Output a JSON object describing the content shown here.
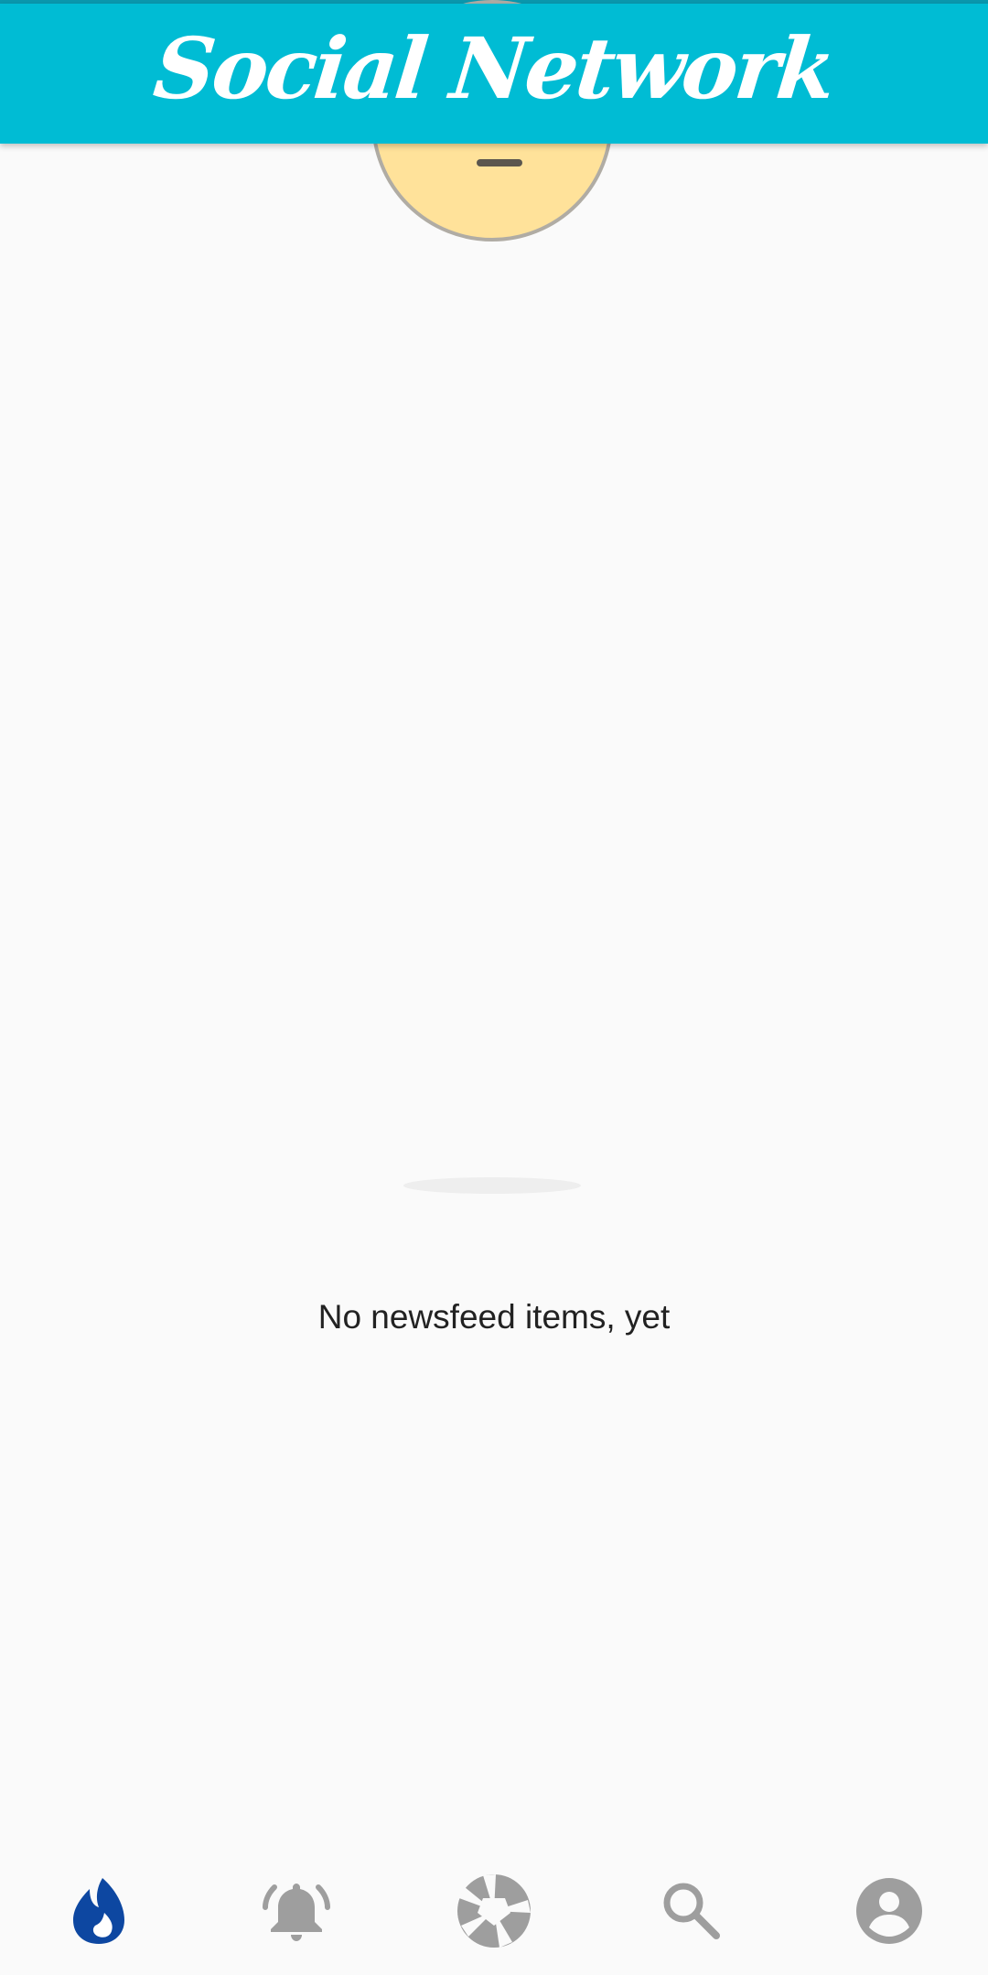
{
  "appbar": {
    "title": "Social Network",
    "color": "#00bcd4"
  },
  "empty_state": {
    "icon": "neutral-face-icon",
    "message": "No newsfeed items, yet",
    "face_color": "#ffe29a"
  },
  "bottom_nav": {
    "active_color": "#0d47a1",
    "inactive_color": "#9e9e9e",
    "items": [
      {
        "icon": "flame-icon",
        "active": true
      },
      {
        "icon": "bell-icon",
        "active": false
      },
      {
        "icon": "camera-aperture-icon",
        "active": false
      },
      {
        "icon": "search-icon",
        "active": false
      },
      {
        "icon": "account-icon",
        "active": false
      }
    ]
  }
}
